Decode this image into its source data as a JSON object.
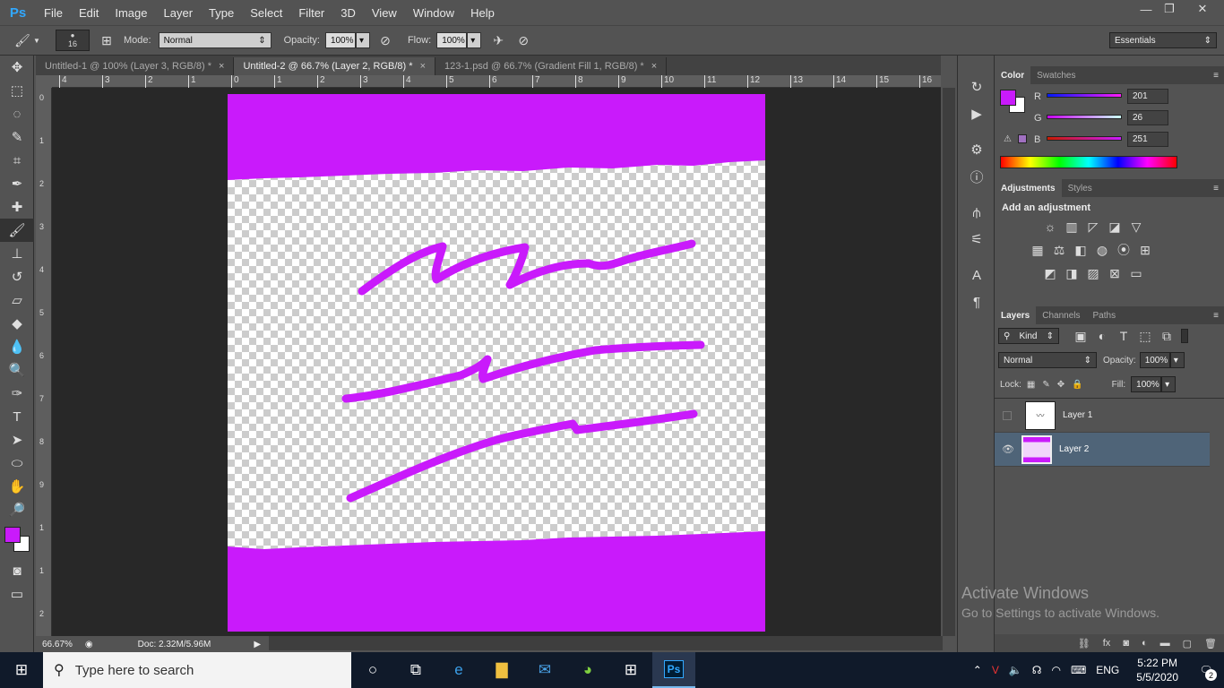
{
  "app": {
    "logo": "Ps"
  },
  "menu": [
    "File",
    "Edit",
    "Image",
    "Layer",
    "Type",
    "Select",
    "Filter",
    "3D",
    "View",
    "Window",
    "Help"
  ],
  "options": {
    "brush_size": "16",
    "mode_label": "Mode:",
    "mode_value": "Normal",
    "opacity_label": "Opacity:",
    "opacity_value": "100%",
    "flow_label": "Flow:",
    "flow_value": "100%",
    "workspace": "Essentials"
  },
  "tabs": [
    {
      "label": "Untitled-1 @ 100% (Layer 3, RGB/8) *",
      "active": false
    },
    {
      "label": "Untitled-2 @ 66.7% (Layer 2, RGB/8) *",
      "active": true
    },
    {
      "label": "123-1.psd @ 66.7% (Gradient Fill 1, RGB/8) *",
      "active": false
    }
  ],
  "ruler_top": [
    "4",
    "3",
    "2",
    "1",
    "0",
    "1",
    "2",
    "3",
    "4",
    "5",
    "6",
    "7",
    "8",
    "9",
    "10",
    "11",
    "12",
    "13",
    "14",
    "15",
    "16"
  ],
  "ruler_left": [
    "0",
    "1",
    "2",
    "3",
    "4",
    "5",
    "6",
    "7",
    "8",
    "9",
    "1",
    "1",
    "2"
  ],
  "status": {
    "zoom": "66.67%",
    "doc": "Doc: 2.32M/5.96M"
  },
  "color_panel": {
    "tabs": [
      "Color",
      "Swatches"
    ],
    "r_label": "R",
    "r_value": "201",
    "g_label": "G",
    "g_value": "26",
    "b_label": "B",
    "b_value": "251",
    "foreground": "#c91afb"
  },
  "adjustments": {
    "tabs": [
      "Adjustments",
      "Styles"
    ],
    "title": "Add an adjustment"
  },
  "layers_panel": {
    "tabs": [
      "Layers",
      "Channels",
      "Paths"
    ],
    "filter_value": "Kind",
    "blend_mode": "Normal",
    "opacity_label": "Opacity:",
    "opacity_value": "100%",
    "lock_label": "Lock:",
    "fill_label": "Fill:",
    "fill_value": "100%",
    "layers": [
      {
        "name": "Layer 1",
        "visible": false,
        "selected": false
      },
      {
        "name": "Layer 2",
        "visible": true,
        "selected": true
      }
    ]
  },
  "watermark": {
    "title": "Activate Windows",
    "subtitle": "Go to Settings to activate Windows."
  },
  "taskbar": {
    "search_placeholder": "Type here to search",
    "time": "5:22 PM",
    "date": "5/5/2020",
    "lang": "ENG",
    "notifications": "2"
  },
  "colors": {
    "brush": "#c91afb",
    "workspace": "#282828",
    "panel": "#535353"
  }
}
